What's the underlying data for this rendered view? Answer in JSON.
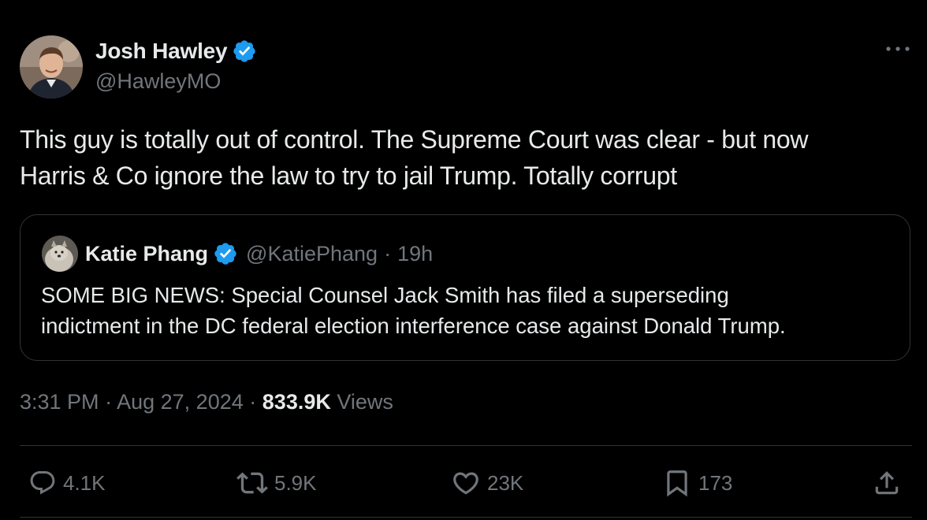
{
  "author": {
    "name": "Josh Hawley",
    "handle": "@HawleyMO",
    "verified": true,
    "avatar": "profile-photo"
  },
  "tweet": {
    "text_line1": "This guy is totally out of control. The Supreme Court was clear - but now",
    "text_line2": "Harris & Co ignore the law to try to jail Trump. Totally corrupt"
  },
  "quoted": {
    "name": "Katie Phang",
    "handle": "@KatiePhang",
    "separator": "·",
    "time": "19h",
    "verified": true,
    "avatar": "profile-photo-dog",
    "text_line1": "SOME BIG NEWS: Special Counsel Jack Smith has filed a superseding",
    "text_line2": "indictment in the DC federal election interference case against Donald Trump."
  },
  "meta": {
    "time": "3:31 PM",
    "separator": "·",
    "date": "Aug 27, 2024",
    "views_count": "833.9K",
    "views_label": "Views"
  },
  "actions": {
    "replies": "4.1K",
    "reposts": "5.9K",
    "likes": "23K",
    "bookmarks": "173"
  },
  "icons": {
    "more": "more-icon",
    "verified": "verified-badge-icon",
    "reply": "reply-icon",
    "repost": "repost-icon",
    "like": "like-icon",
    "bookmark": "bookmark-icon",
    "share": "share-icon"
  },
  "colors": {
    "background": "#000000",
    "text_primary": "#e7e9ea",
    "text_secondary": "#71767b",
    "verified_blue": "#1d9bf0",
    "border": "#2f3336"
  }
}
